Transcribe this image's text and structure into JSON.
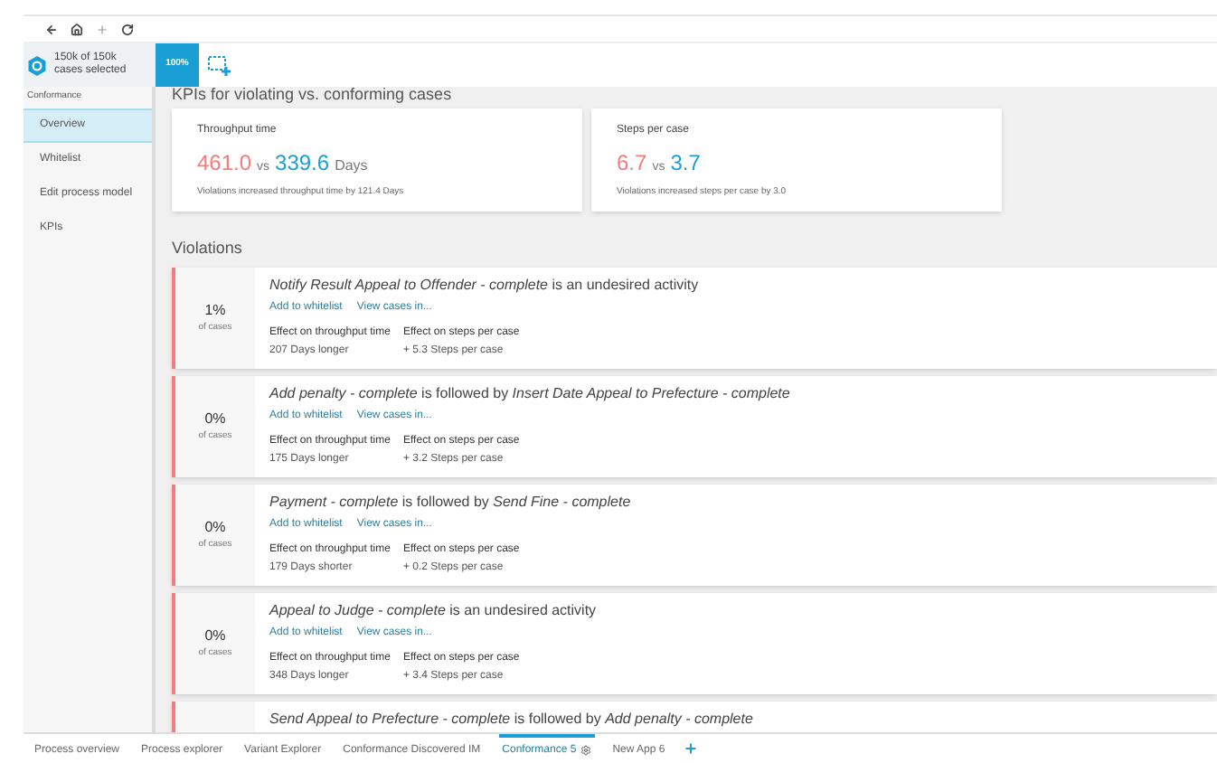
{
  "header": {
    "selection": "150k of 150k",
    "selection_sub": "cases selected",
    "percent": "100%"
  },
  "sidebar": {
    "section": "Conformance",
    "items": [
      {
        "label": "Overview",
        "selected": true
      },
      {
        "label": "Whitelist",
        "selected": false
      },
      {
        "label": "Edit process model",
        "selected": false
      },
      {
        "label": "KPIs",
        "selected": false
      }
    ]
  },
  "kpis": {
    "title": "KPIs for violating vs. conforming cases",
    "cards": [
      {
        "label": "Throughput time",
        "violating": "461.0",
        "vs": "vs",
        "conforming": "339.6",
        "unit": "Days",
        "note": "Violations increased throughput time by 121.4 Days"
      },
      {
        "label": "Steps per case",
        "violating": "6.7",
        "vs": "vs",
        "conforming": "3.7",
        "note": "Violations increased steps per case by 3.0"
      }
    ]
  },
  "violations": {
    "title": "Violations",
    "items": [
      {
        "percent": "1%",
        "percent_sub": "of cases",
        "title": "*Notify Result Appeal to Offender - complete* is an undesired activity",
        "actions": [
          "Add to whitelist",
          "View cases in..."
        ],
        "effects": [
          {
            "label": "Effect on throughput time",
            "value": "207 Days longer"
          },
          {
            "label": "Effect on steps per case",
            "value": "+ 5.3 Steps per case"
          }
        ]
      },
      {
        "percent": "0%",
        "percent_sub": "of cases",
        "title": "*Add penalty - complete* is followed by *Insert Date Appeal to Prefecture - complete*",
        "actions": [
          "Add to whitelist",
          "View cases in..."
        ],
        "effects": [
          {
            "label": "Effect on throughput time",
            "value": "175 Days longer"
          },
          {
            "label": "Effect on steps per case",
            "value": "+ 3.2 Steps per case"
          }
        ]
      },
      {
        "percent": "0%",
        "percent_sub": "of cases",
        "title": "*Payment - complete* is followed by *Send Fine - complete*",
        "actions": [
          "Add to whitelist",
          "View cases in..."
        ],
        "effects": [
          {
            "label": "Effect on throughput time",
            "value": "179 Days shorter"
          },
          {
            "label": "Effect on steps per case",
            "value": "+ 0.2 Steps per case"
          }
        ]
      },
      {
        "percent": "0%",
        "percent_sub": "of cases",
        "title": "*Appeal to Judge - complete* is an undesired activity",
        "actions": [
          "Add to whitelist",
          "View cases in..."
        ],
        "effects": [
          {
            "label": "Effect on throughput time",
            "value": "348 Days longer"
          },
          {
            "label": "Effect on steps per case",
            "value": "+ 3.4 Steps per case"
          }
        ]
      },
      {
        "title": "*Send Appeal to Prefecture - complete* is followed by *Add penalty - complete*"
      }
    ]
  },
  "tabs": [
    {
      "label": "Process overview",
      "selected": false
    },
    {
      "label": "Process explorer",
      "selected": false
    },
    {
      "label": "Variant Explorer",
      "selected": false
    },
    {
      "label": "Conformance Discovered IM",
      "selected": false
    },
    {
      "label": "Conformance 5",
      "selected": true,
      "settings": true
    },
    {
      "label": "New App 6",
      "selected": false
    }
  ]
}
